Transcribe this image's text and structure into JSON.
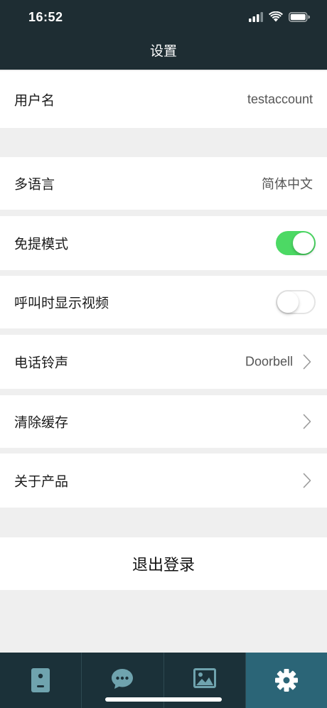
{
  "status_bar": {
    "time": "16:52"
  },
  "nav": {
    "title": "设置"
  },
  "settings": {
    "username_label": "用户名",
    "username_value": "testaccount",
    "language_label": "多语言",
    "language_value": "简体中文",
    "handsfree_label": "免提模式",
    "handsfree_enabled": true,
    "video_on_call_label": "呼叫时显示视频",
    "video_on_call_enabled": false,
    "ringtone_label": "电话铃声",
    "ringtone_value": "Doorbell",
    "clear_cache_label": "清除缓存",
    "about_label": "关于产品"
  },
  "logout": {
    "label": "退出登录"
  },
  "tab_bar": {
    "tabs": [
      {
        "icon": "intercom-device-icon",
        "active": false
      },
      {
        "icon": "chat-bubble-icon",
        "active": false
      },
      {
        "icon": "image-icon",
        "active": false
      },
      {
        "icon": "gear-icon",
        "active": true
      }
    ]
  },
  "colors": {
    "header_bg": "#1e2d33",
    "toggle_on": "#4cd964",
    "tab_bar_bg": "#1b3139",
    "tab_active_bg": "#2b6577",
    "tab_icon": "#6fa3ae"
  }
}
